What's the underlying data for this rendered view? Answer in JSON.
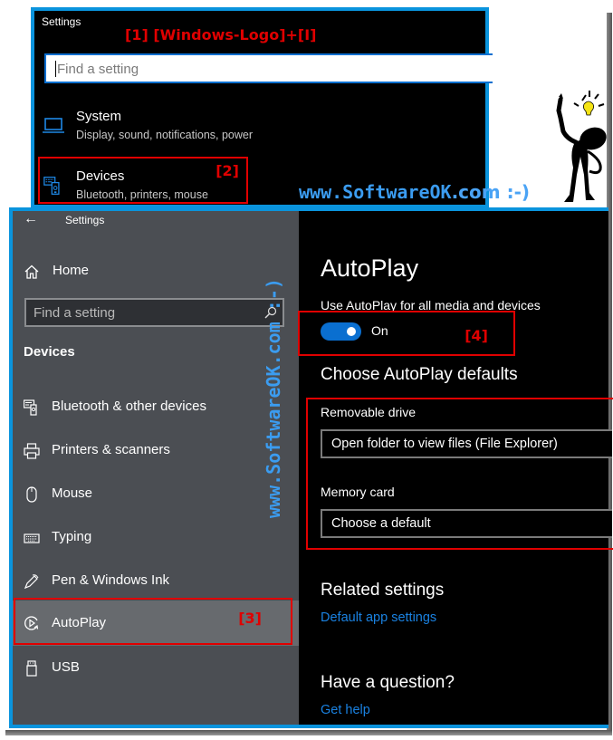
{
  "top_window": {
    "title": "Settings",
    "annotation": "[1] [Windows-Logo]+[I]",
    "search_placeholder": "Find a setting",
    "categories": [
      {
        "name": "System",
        "description": "Display, sound, notifications, power",
        "icon": "laptop-icon"
      },
      {
        "name": "Devices",
        "description": "Bluetooth, printers, mouse",
        "icon": "devices-icon",
        "annotation": "[2]"
      }
    ]
  },
  "watermark": {
    "horizontal_main": "www.SoftwareOK",
    "horizontal_tail": ".com :-)",
    "vertical": "www.SoftwareOK.com :-)"
  },
  "main_window": {
    "title": "Settings",
    "back_icon": "back-arrow-icon",
    "home_label": "Home",
    "search_placeholder": "Find a setting",
    "section": "Devices",
    "nav_items": [
      {
        "label": "Bluetooth & other devices",
        "icon": "bluetooth-devices-icon"
      },
      {
        "label": "Printers & scanners",
        "icon": "printer-icon"
      },
      {
        "label": "Mouse",
        "icon": "mouse-icon"
      },
      {
        "label": "Typing",
        "icon": "keyboard-icon"
      },
      {
        "label": "Pen & Windows Ink",
        "icon": "pen-icon"
      },
      {
        "label": "AutoPlay",
        "icon": "autoplay-icon",
        "selected": true,
        "annotation": "[3]"
      },
      {
        "label": "USB",
        "icon": "usb-icon"
      }
    ],
    "content": {
      "title": "AutoPlay",
      "toggle_label": "Use AutoPlay for all media and devices",
      "toggle_state": "On",
      "toggle_on": true,
      "toggle_annotation": "[4]",
      "defaults_heading": "Choose AutoPlay defaults",
      "removable_drive_label": "Removable drive",
      "removable_drive_value": "Open folder to view files (File Explorer)",
      "memory_card_label": "Memory card",
      "memory_card_value": "Choose a default",
      "related_heading": "Related settings",
      "related_link": "Default app settings",
      "question_heading": "Have a question?",
      "help_link": "Get help"
    }
  },
  "colors": {
    "accent": "#0a6fd0",
    "frame_blue": "#0a94dd",
    "annotation_red": "#e00000",
    "link_blue": "#1a82e2",
    "sidebar_bg": "#4b4e53",
    "watermark_blue": "#3b9cf0"
  }
}
